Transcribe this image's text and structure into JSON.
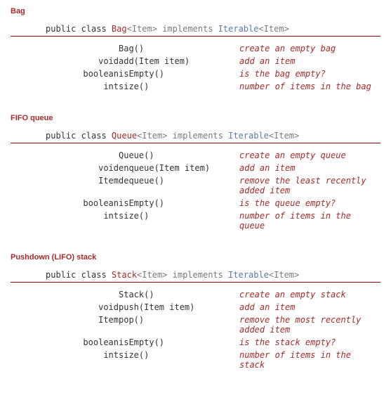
{
  "sections": [
    {
      "title": "Bag",
      "decl": {
        "prefix": "public class ",
        "classname": "Bag",
        "generic": "<Item>",
        "impl": " implements ",
        "iface": "Iterable",
        "iface_generic": "<Item>"
      },
      "rows": [
        {
          "ret": "",
          "sig": "Bag()",
          "desc": "create an empty bag"
        },
        {
          "ret": "void",
          "sig": "add(Item item)",
          "desc": "add an item"
        },
        {
          "ret": "boolean",
          "sig": "isEmpty()",
          "desc": "is the bag empty?"
        },
        {
          "ret": "int",
          "sig": "size()",
          "desc": "number of items in the bag"
        }
      ]
    },
    {
      "title": "FIFO queue",
      "decl": {
        "prefix": "public class ",
        "classname": "Queue",
        "generic": "<Item>",
        "impl": " implements ",
        "iface": "Iterable",
        "iface_generic": "<Item>"
      },
      "rows": [
        {
          "ret": "",
          "sig": "Queue()",
          "desc": "create an empty queue"
        },
        {
          "ret": "void",
          "sig": "enqueue(Item item)",
          "desc": "add an item"
        },
        {
          "ret": "Item",
          "sig": "dequeue()",
          "desc": "remove the least recently added item"
        },
        {
          "ret": "boolean",
          "sig": "isEmpty()",
          "desc": "is the queue empty?"
        },
        {
          "ret": "int",
          "sig": "size()",
          "desc": "number of items in the queue"
        }
      ]
    },
    {
      "title": "Pushdown (LIFO) stack",
      "decl": {
        "prefix": "public class ",
        "classname": "Stack",
        "generic": "<Item>",
        "impl": " implements ",
        "iface": "Iterable",
        "iface_generic": "<Item>"
      },
      "rows": [
        {
          "ret": "",
          "sig": "Stack()",
          "desc": "create an empty stack"
        },
        {
          "ret": "void",
          "sig": "push(Item item)",
          "desc": "add an item"
        },
        {
          "ret": "Item",
          "sig": "pop()",
          "desc": "remove the most recently added item"
        },
        {
          "ret": "boolean",
          "sig": "isEmpty()",
          "desc": "is the stack empty?"
        },
        {
          "ret": "int",
          "sig": "size()",
          "desc": "number of items in the stack"
        }
      ]
    }
  ]
}
